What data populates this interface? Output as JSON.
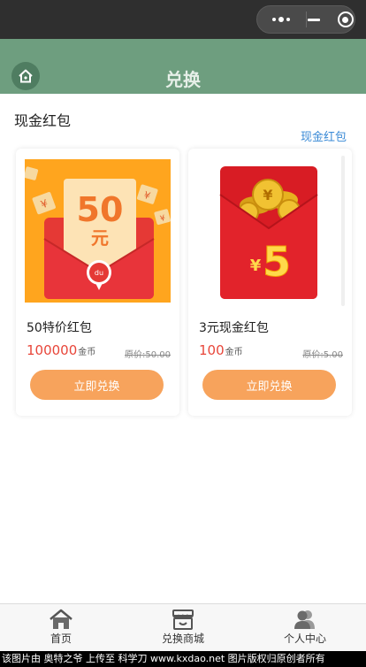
{
  "header": {
    "title": "兑换"
  },
  "section": {
    "title": "现金红包",
    "link": "现金红包"
  },
  "products": [
    {
      "name": "50特价红包",
      "price": "100000",
      "unit": "金币",
      "original": "原价:50.00",
      "button": "立即兑换",
      "image_text": "50",
      "image_subtext": "元",
      "image_logo": "du"
    },
    {
      "name": "3元现金红包",
      "price": "100",
      "unit": "金币",
      "original": "原价:5.00",
      "button": "立即兑换",
      "image_text": "5",
      "image_currency": "¥"
    }
  ],
  "tabs": [
    {
      "label": "首页",
      "icon": "home-icon"
    },
    {
      "label": "兑换商城",
      "icon": "store-icon"
    },
    {
      "label": "个人中心",
      "icon": "users-icon"
    }
  ],
  "watermark": "该图片由 奥特之爷 上传至 科学刀 www.kxdao.net 图片版权归原创者所有",
  "colors": {
    "nav": "#6e9e7f",
    "accent": "#f7a35c",
    "price": "#e8463a",
    "link": "#3a8ad6"
  }
}
